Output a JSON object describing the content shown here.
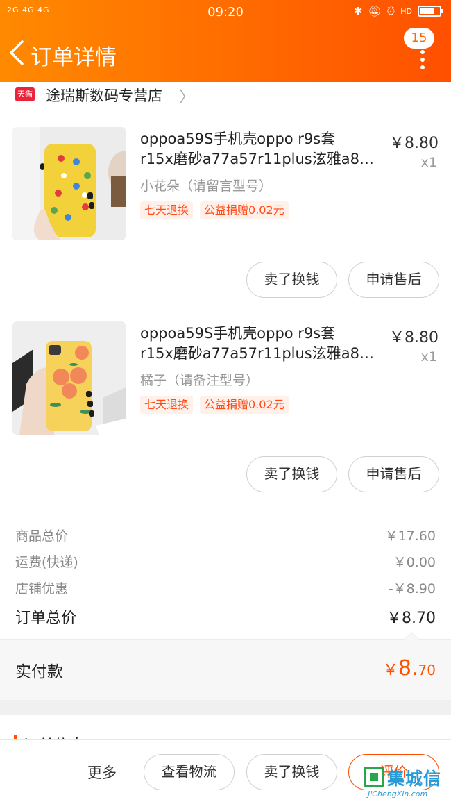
{
  "status_bar": {
    "network": "2G 4G 4G",
    "time": "09:20",
    "hd": "HD"
  },
  "header": {
    "title": "订单详情",
    "message_count": "15"
  },
  "shop": {
    "badge": "天猫",
    "name": "途瑞斯数码专营店"
  },
  "products": [
    {
      "title_line1": "oppoa59S手机壳oppo r9s套",
      "title_line2": "r15x磨砂a77a57r11plus泫雅a8…",
      "price": "￥8.80",
      "qty": "x1",
      "spec": "小花朵（请留言型号）",
      "tags": [
        "七天退换",
        "公益捐赠0.02元"
      ],
      "buttons": [
        "卖了换钱",
        "申请售后"
      ]
    },
    {
      "title_line1": "oppoa59S手机壳oppo r9s套",
      "title_line2": "r15x磨砂a77a57r11plus泫雅a8…",
      "price": "￥8.80",
      "qty": "x1",
      "spec": "橘子（请备注型号）",
      "tags": [
        "七天退换",
        "公益捐赠0.02元"
      ],
      "buttons": [
        "卖了换钱",
        "申请售后"
      ]
    }
  ],
  "summary": {
    "items_total_label": "商品总价",
    "items_total": "￥17.60",
    "shipping_label": "运费(快递)",
    "shipping": "￥0.00",
    "discount_label": "店铺优惠",
    "discount": "-￥8.90",
    "order_total_label": "订单总价",
    "order_total": "￥8.70"
  },
  "paid": {
    "label": "实付款",
    "currency": "￥",
    "integer": "8.",
    "decimal": "70"
  },
  "order_info": {
    "heading": "订单信息"
  },
  "bottom_bar": {
    "more": "更多",
    "logistics": "查看物流",
    "resell": "卖了换钱",
    "review": "评价"
  },
  "watermark": {
    "text": "集城信",
    "sub": "JiChengXin.com"
  },
  "colors": {
    "accent": "#ff5000",
    "header_start": "#ff8a00",
    "tag_bg": "#fff0ea"
  }
}
